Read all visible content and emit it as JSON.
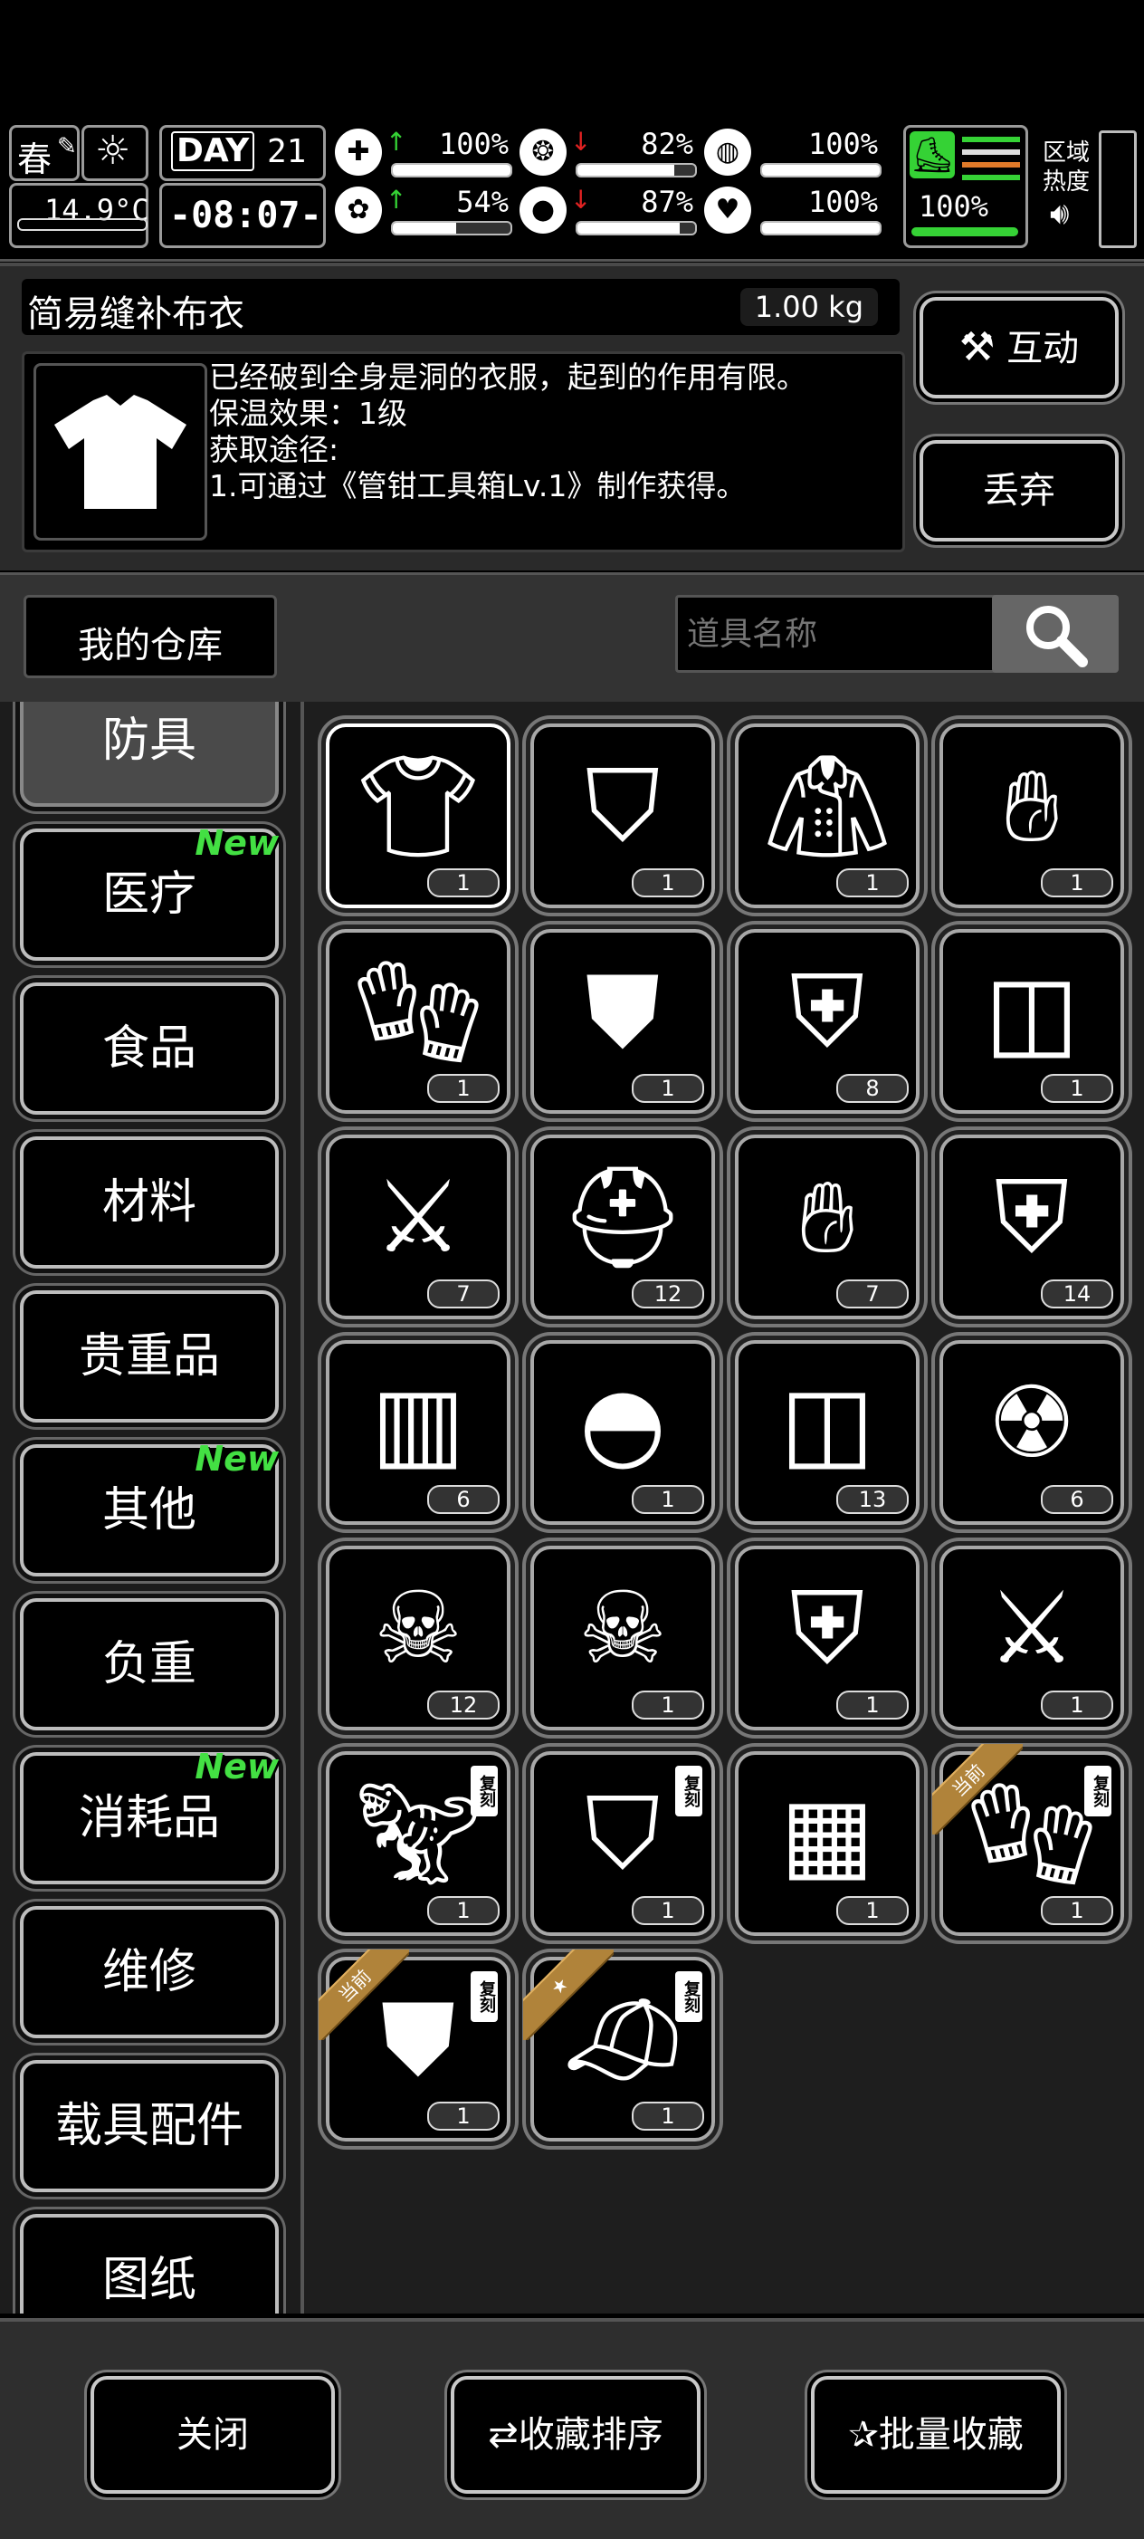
{
  "status": {
    "season": "春",
    "day_label": "DAY",
    "day_num": "21",
    "temperature": "14.9°C",
    "clock": "-08:07-",
    "stats": [
      {
        "icon": "medkit-icon",
        "arrow": "up",
        "value": "100%",
        "fill": 1.0
      },
      {
        "icon": "stomach-icon",
        "arrow": "down",
        "value": "82%",
        "fill": 0.82
      },
      {
        "icon": "lungs-icon",
        "arrow": "",
        "value": "100%",
        "fill": 1.0
      },
      {
        "icon": "brain-icon",
        "arrow": "up",
        "value": "54%",
        "fill": 0.54
      },
      {
        "icon": "water-drop-icon",
        "arrow": "down",
        "value": "87%",
        "fill": 0.87
      },
      {
        "icon": "heart-icon",
        "arrow": "",
        "value": "100%",
        "fill": 1.0
      }
    ],
    "stamina_value": "100%",
    "stamina_fill": 1.0,
    "region_label": "区域",
    "heat_label": "热度",
    "colors": {
      "green": "#35d235",
      "red": "#e22222",
      "orange": "#e07a2a"
    }
  },
  "item": {
    "name": "简易缝补布衣",
    "weight": "1.00 kg",
    "desc_line1": "已经破到全身是洞的衣服，起到的作用有限。",
    "desc_line2": "保温效果：1级",
    "desc_line3": "获取途径:",
    "desc_line4": "1.可通过《管钳工具箱Lv.1》制作获得。",
    "interact_label": "互动",
    "discard_label": "丢弃"
  },
  "warehouse": {
    "title": "我的仓库",
    "search_placeholder": "道具名称"
  },
  "categories": [
    {
      "label": "防具",
      "new": "",
      "active": true
    },
    {
      "label": "医疗",
      "new": "New"
    },
    {
      "label": "食品",
      "new": ""
    },
    {
      "label": "材料",
      "new": ""
    },
    {
      "label": "贵重品",
      "new": ""
    },
    {
      "label": "其他",
      "new": "New"
    },
    {
      "label": "负重",
      "new": ""
    },
    {
      "label": "消耗品",
      "new": "New"
    },
    {
      "label": "维修",
      "new": ""
    },
    {
      "label": "载具配件",
      "new": ""
    },
    {
      "label": "图纸",
      "new": ""
    }
  ],
  "items": [
    {
      "icon": "tshirt-icon",
      "qty": "1"
    },
    {
      "icon": "ragged-pants-icon",
      "qty": "1"
    },
    {
      "icon": "jacket-icon",
      "qty": "1"
    },
    {
      "icon": "glove-icon",
      "qty": "1"
    },
    {
      "icon": "tactical-gloves-icon",
      "qty": "1"
    },
    {
      "icon": "fur-coat-icon",
      "qty": "1"
    },
    {
      "icon": "body-armor-icon",
      "qty": "8"
    },
    {
      "icon": "knee-pads-icon",
      "qty": "1"
    },
    {
      "icon": "shin-guards-icon",
      "qty": "7"
    },
    {
      "icon": "helmet-icon",
      "qty": "12"
    },
    {
      "icon": "hands-gloves-icon",
      "qty": "7"
    },
    {
      "icon": "exo-armor-icon",
      "qty": "14"
    },
    {
      "icon": "vest-icon",
      "qty": "6"
    },
    {
      "icon": "hood-icon",
      "qty": "1"
    },
    {
      "icon": "knee-pads-icon",
      "qty": "13"
    },
    {
      "icon": "gas-mask-icon",
      "qty": "6"
    },
    {
      "icon": "skull-helmet-icon",
      "qty": "12"
    },
    {
      "icon": "skull-helmet-icon",
      "qty": "1"
    },
    {
      "icon": "body-armor-icon",
      "qty": "1"
    },
    {
      "icon": "shin-guards-icon",
      "qty": "1"
    },
    {
      "icon": "dino-mask-icon",
      "qty": "1",
      "tag": "复刻"
    },
    {
      "icon": "shorts-icon",
      "qty": "1",
      "tag": "复刻"
    },
    {
      "icon": "utility-vest-icon",
      "qty": "1"
    },
    {
      "icon": "scale-gloves-icon",
      "qty": "1",
      "tag": "复刻",
      "ribbon": "当前"
    },
    {
      "icon": "scarf-icon",
      "qty": "1",
      "tag": "复刻",
      "ribbon": "当前"
    },
    {
      "icon": "cap-icon",
      "qty": "1",
      "tag": "复刻",
      "ribbon": "★"
    }
  ],
  "bottom": {
    "close_label": "关闭",
    "sort_label": "收藏排序",
    "batch_label": "批量收藏"
  }
}
